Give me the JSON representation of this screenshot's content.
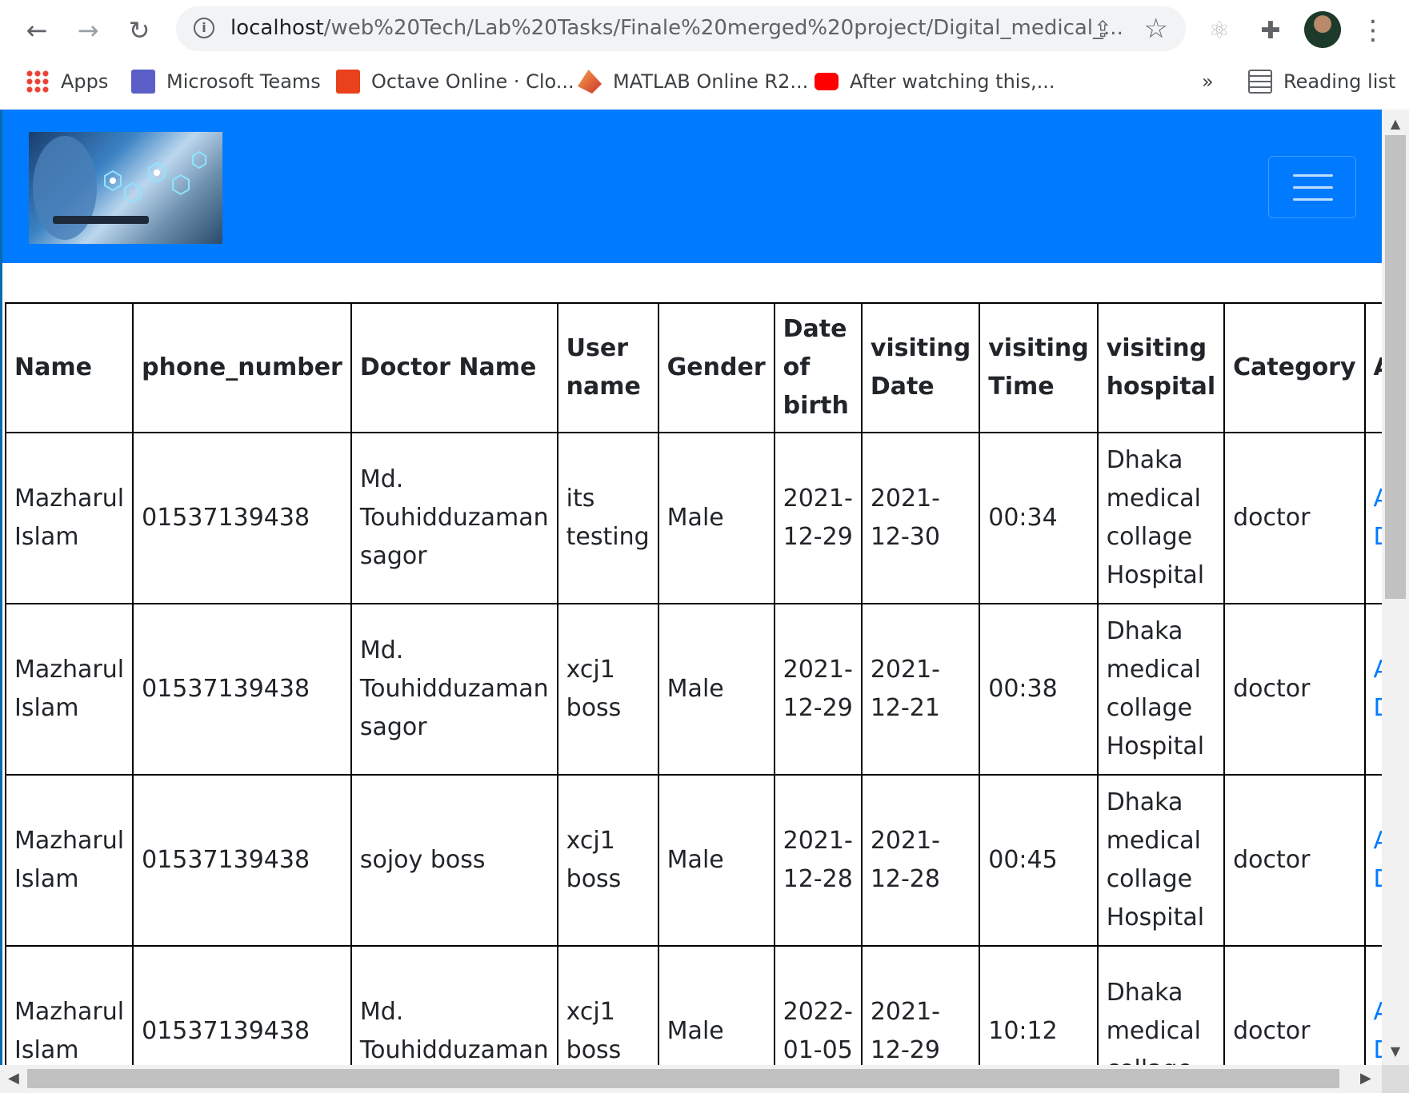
{
  "browser": {
    "url_host": "localhost",
    "url_path": "/web%20Tech/Lab%20Tasks/Finale%20merged%20project/Digital_medical_...",
    "bookmarks": [
      {
        "label": "Apps",
        "icon": "apps-grid-icon",
        "color": "#ea4335"
      },
      {
        "label": "Microsoft Teams",
        "icon": "teams-icon",
        "color": "#5b5fc7"
      },
      {
        "label": "Octave Online · Clo...",
        "icon": "octave-icon",
        "color": "#e8411c"
      },
      {
        "label": "MATLAB Online R2...",
        "icon": "matlab-icon",
        "color": "#e16737"
      },
      {
        "label": "After watching this,...",
        "icon": "youtube-icon",
        "color": "#ff0000"
      }
    ],
    "more_bookmarks": "»",
    "reading_list": "Reading list"
  },
  "page": {
    "navbar_color": "#007bff",
    "logo_alt": "medical-logo-image"
  },
  "table": {
    "headers": [
      "Name",
      "phone_number",
      "Doctor Name",
      "User name",
      "Gender",
      "Date of birth",
      "visiting Date",
      "visiting Time",
      "visiting hospital",
      "Category",
      "Approval"
    ],
    "rows": [
      {
        "name": "Mazharul Islam",
        "phone": "01537139438",
        "doctor": "Md. Touhidduzaman sagor",
        "username": "its testing",
        "gender": "Male",
        "dob": "2021-12-29",
        "vdate": "2021-12-30",
        "vtime": "00:34",
        "hospital": "Dhaka medical collage Hospital",
        "category": "doctor",
        "accept": "Accept",
        "delete": "Delete"
      },
      {
        "name": "Mazharul Islam",
        "phone": "01537139438",
        "doctor": "Md. Touhidduzaman sagor",
        "username": "xcj1 boss",
        "gender": "Male",
        "dob": "2021-12-29",
        "vdate": "2021-12-21",
        "vtime": "00:38",
        "hospital": "Dhaka medical collage Hospital",
        "category": "doctor",
        "accept": "Accept",
        "delete": "Delete"
      },
      {
        "name": "Mazharul Islam",
        "phone": "01537139438",
        "doctor": "sojoy boss",
        "username": "xcj1 boss",
        "gender": "Male",
        "dob": "2021-12-28",
        "vdate": "2021-12-28",
        "vtime": "00:45",
        "hospital": "Dhaka medical collage Hospital",
        "category": "doctor",
        "accept": "Accept",
        "delete": "Delete"
      },
      {
        "name": "Mazharul Islam",
        "phone": "01537139438",
        "doctor": "Md. Touhidduzaman",
        "username": "xcj1 boss",
        "gender": "Male",
        "dob": "2022-01-05",
        "vdate": "2021-12-29",
        "vtime": "10:12",
        "hospital": "Dhaka medical collage",
        "category": "doctor",
        "accept": "Accept",
        "delete": "Delete"
      }
    ]
  }
}
